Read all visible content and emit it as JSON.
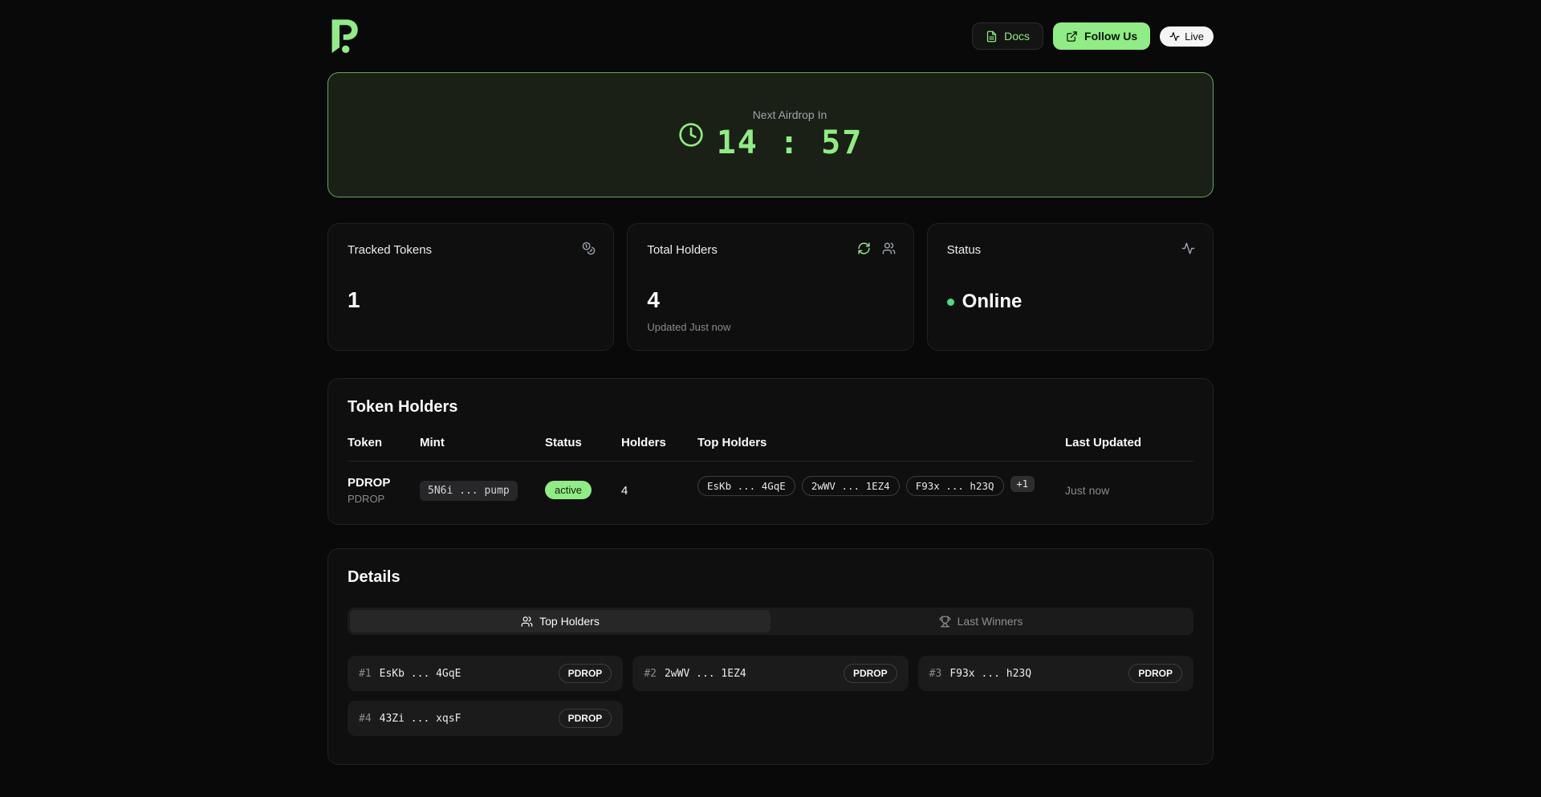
{
  "header": {
    "docs_label": "Docs",
    "follow_label": "Follow Us",
    "live_label": "Live"
  },
  "countdown": {
    "label": "Next Airdrop In",
    "time": "14 : 57"
  },
  "stats": {
    "tracked_tokens": {
      "title": "Tracked Tokens",
      "value": "1"
    },
    "total_holders": {
      "title": "Total Holders",
      "value": "4",
      "subtext": "Updated Just now"
    },
    "status": {
      "title": "Status",
      "value": "Online"
    }
  },
  "token_table": {
    "title": "Token Holders",
    "columns": [
      "Token",
      "Mint",
      "Status",
      "Holders",
      "Top Holders",
      "Last Updated"
    ],
    "row": {
      "token_name": "PDROP",
      "token_symbol": "PDROP",
      "mint": "5N6i ... pump",
      "status": "active",
      "holders": "4",
      "top_holders": [
        "EsKb ... 4GqE",
        "2wWV ... 1EZ4",
        "F93x ... h23Q"
      ],
      "more": "+1",
      "last_updated": "Just now"
    }
  },
  "details": {
    "title": "Details",
    "tabs": [
      {
        "label": "Top Holders"
      },
      {
        "label": "Last Winners"
      }
    ],
    "holders": [
      {
        "rank": "#1",
        "address": "EsKb ... 4GqE",
        "token": "PDROP"
      },
      {
        "rank": "#2",
        "address": "2wWV ... 1EZ4",
        "token": "PDROP"
      },
      {
        "rank": "#3",
        "address": "F93x ... h23Q",
        "token": "PDROP"
      },
      {
        "rank": "#4",
        "address": "43Zi ... xqsF",
        "token": "PDROP"
      }
    ]
  },
  "icons": {
    "logo": "pdrop-logo",
    "docs": "file-text-icon",
    "follow": "external-link-icon",
    "live": "activity-icon",
    "countdown": "clock-icon",
    "tracked_tokens": "coins-icon",
    "refresh": "refresh-icon",
    "holders": "users-icon",
    "status": "activity-icon",
    "tab_top_holders": "users-icon",
    "tab_last_winners": "trophy-icon"
  },
  "colors": {
    "accent_green": "#90ec84",
    "online_dot": "#4ade80",
    "countdown_bg": "#1a2015",
    "page_bg": "#090909",
    "card_bg": "#0f0f0f"
  }
}
